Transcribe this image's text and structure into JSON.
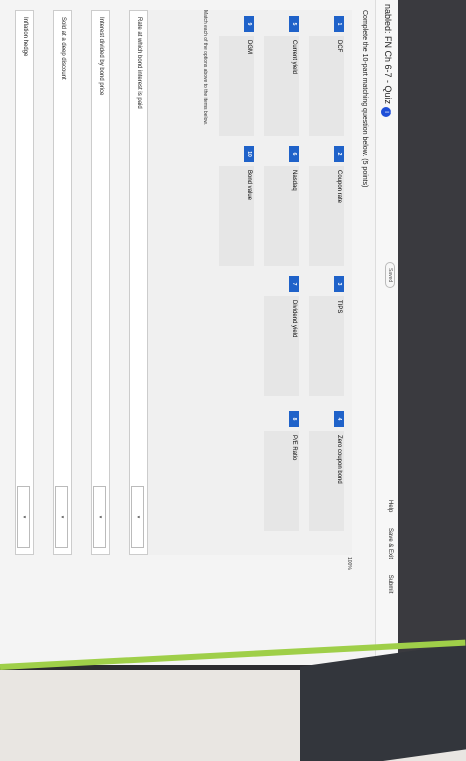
{
  "header": {
    "title": "nabled: FN Ch 6-7 - Quiz",
    "saved": "Saved",
    "help": "Help",
    "save_exit": "Save & Exit",
    "submit": "Submit"
  },
  "question": "Complete the 10-part matching question below. (5 points)",
  "options": [
    {
      "num": "1",
      "label": "DCF"
    },
    {
      "num": "2",
      "label": "Coupon rate"
    },
    {
      "num": "3",
      "label": "TIPS"
    },
    {
      "num": "4",
      "label": "Zero coupon bond"
    },
    {
      "num": "5",
      "label": "Current yield"
    },
    {
      "num": "6",
      "label": "Nasdaq"
    },
    {
      "num": "7",
      "label": "Dividend yield"
    },
    {
      "num": "8",
      "label": "P/E Ratio"
    },
    {
      "num": "9",
      "label": "DGM"
    },
    {
      "num": "10",
      "label": "Bond value"
    }
  ],
  "match_label": "Match each of the options above to the items below.",
  "items": [
    {
      "label": "Rate at which bond interest is paid"
    },
    {
      "label": "Interest divided by bond price"
    },
    {
      "label": "Sold at a deep discount"
    },
    {
      "label": "Inflation hedge"
    }
  ],
  "zoom": "100%",
  "colors": {
    "accent": "#1f62c9",
    "green": "#9fcf49"
  }
}
